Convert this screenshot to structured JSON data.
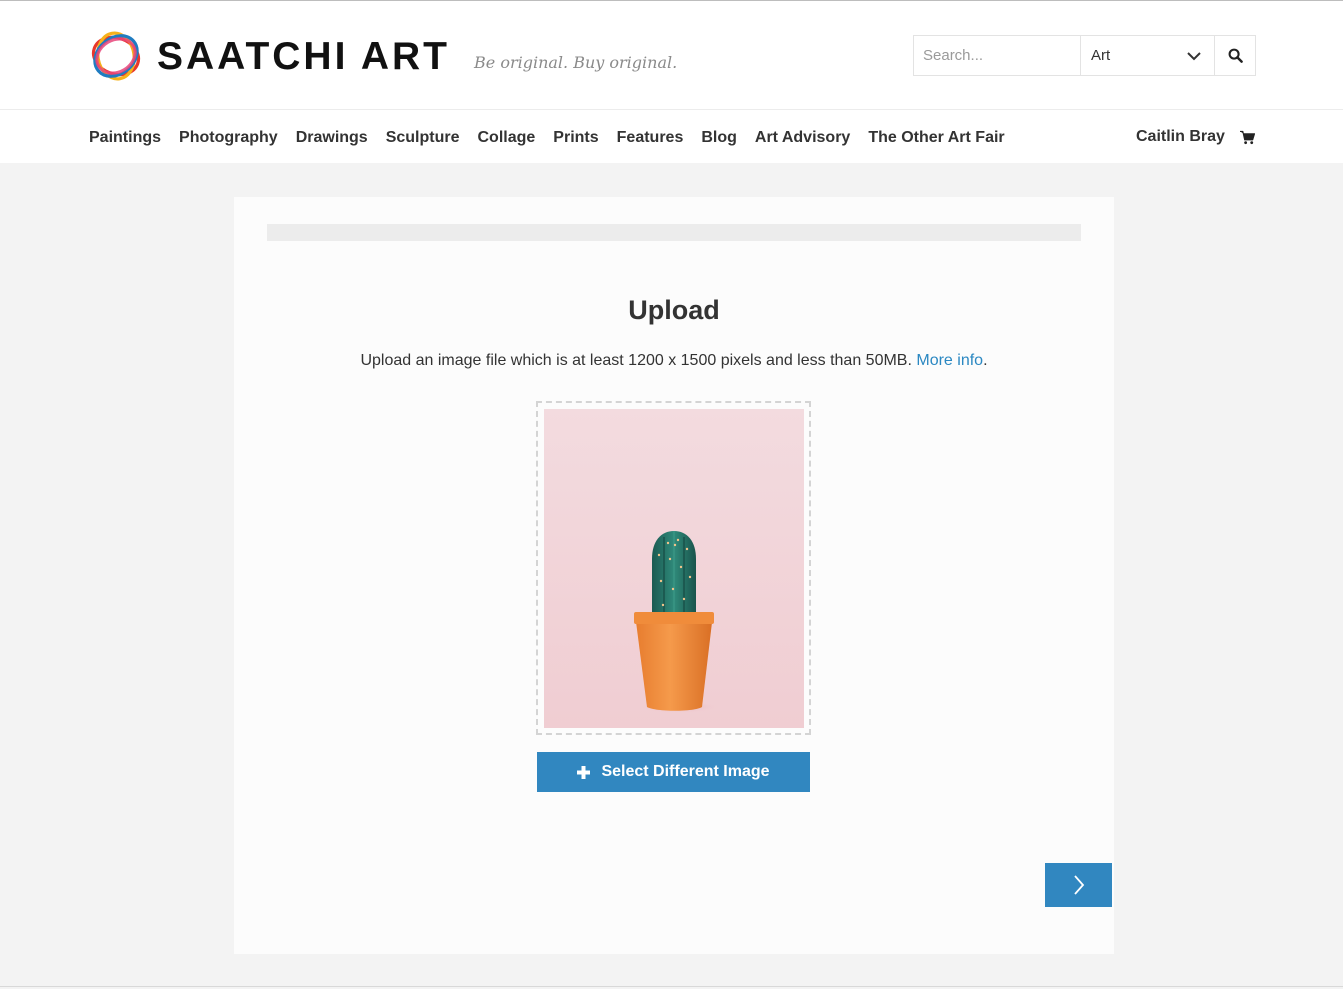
{
  "brand": {
    "name": "SAATCHI ART",
    "tagline": "Be original. Buy original."
  },
  "search": {
    "placeholder": "Search...",
    "category_selected": "Art"
  },
  "nav": {
    "items": [
      "Paintings",
      "Photography",
      "Drawings",
      "Sculpture",
      "Collage",
      "Prints",
      "Features",
      "Blog",
      "Art Advisory",
      "The Other Art Fair"
    ],
    "user_name": "Caitlin Bray"
  },
  "upload": {
    "progress_percent": 0,
    "title": "Upload",
    "description": "Upload an image file which is at least 1200 x 1500 pixels and less than 50MB.",
    "more_info_link": "More info",
    "description_end": ".",
    "select_button_label": "Select Different Image"
  },
  "icons": {
    "logo": "saatchi-rings-logo",
    "dropdown": "chevron-down-icon",
    "search": "magnifier-icon",
    "cart": "cart-icon",
    "plus": "plus-icon",
    "next": "chevron-right-icon"
  },
  "colors": {
    "accent": "#3187c0",
    "link": "#2b88c2",
    "page_bg": "#f3f3f3",
    "progress_track": "#ececec",
    "preview_bg": "#f2d6da",
    "pot": "#ee8a3a",
    "cactus": "#246d63"
  }
}
